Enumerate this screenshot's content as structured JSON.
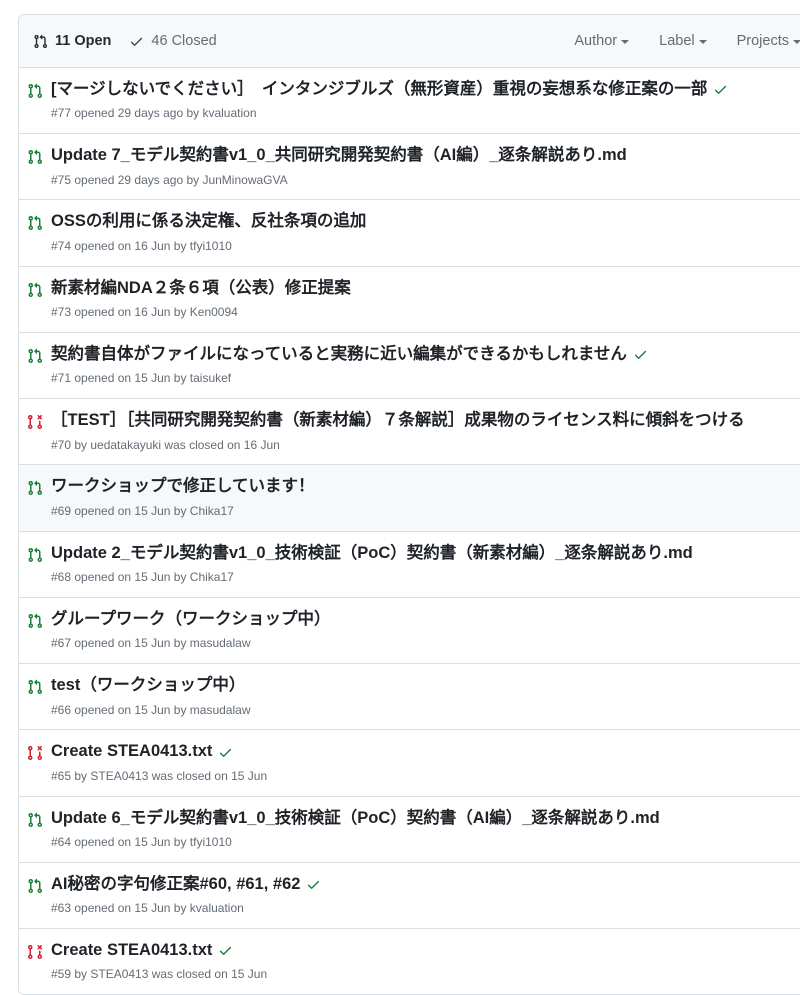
{
  "header": {
    "state_filters": [
      {
        "icon": "pull-request-icon",
        "label": "11 Open",
        "selected": true
      },
      {
        "icon": "check-icon",
        "label": "46 Closed",
        "selected": false
      }
    ],
    "dropdown_filters": [
      {
        "label": "Author"
      },
      {
        "label": "Label"
      },
      {
        "label": "Projects"
      }
    ]
  },
  "colors": {
    "open_green": "#1a7f37",
    "closed_red": "#cf222e",
    "check_green": "#1a7f37",
    "border": "#d8dee4",
    "header_bg": "#f6f8fa",
    "hover_bg": "#f6f8fa",
    "title": "#1f2328",
    "meta": "#636c76"
  },
  "pull_requests": [
    {
      "title": "[マージしないでください］　インタンジブルズ（無形資産）重視の妄想系な修正案の一部",
      "meta": "#77 opened 29 days ago by kvaluation",
      "state": "open",
      "has_check": true,
      "hovered": false
    },
    {
      "title": "Update 7_モデル契約書v1_0_共同研究開発契約書（AI編）_逐条解説あり.md",
      "meta": "#75 opened 29 days ago by JunMinowaGVA",
      "state": "open",
      "has_check": false,
      "hovered": false
    },
    {
      "title": "OSSの利用に係る決定権、反社条項の追加",
      "meta": "#74 opened on 16 Jun by tfyi1010",
      "state": "open",
      "has_check": false,
      "hovered": false
    },
    {
      "title": "新素材編NDA２条６項（公表）修正提案",
      "meta": "#73 opened on 16 Jun by Ken0094",
      "state": "open",
      "has_check": false,
      "hovered": false
    },
    {
      "title": "契約書自体がファイルになっていると実務に近い編集ができるかもしれません",
      "meta": "#71 opened on 15 Jun by taisukef",
      "state": "open",
      "has_check": true,
      "hovered": false
    },
    {
      "title": "［TEST］［共同研究開発契約書（新素材編）７条解説］成果物のライセンス料に傾斜をつける",
      "meta": "#70 by uedatakayuki was closed on 16 Jun",
      "state": "closed",
      "has_check": false,
      "hovered": false
    },
    {
      "title": "ワークショップで修正しています！",
      "meta": "#69 opened on 15 Jun by Chika17",
      "state": "open",
      "has_check": false,
      "hovered": true
    },
    {
      "title": "Update 2_モデル契約書v1_0_技術検証（PoC）契約書（新素材編）_逐条解説あり.md",
      "meta": "#68 opened on 15 Jun by Chika17",
      "state": "open",
      "has_check": false,
      "hovered": false
    },
    {
      "title": "グループワーク（ワークショップ中）",
      "meta": "#67 opened on 15 Jun by masudalaw",
      "state": "open",
      "has_check": false,
      "hovered": false
    },
    {
      "title": "test（ワークショップ中）",
      "meta": "#66 opened on 15 Jun by masudalaw",
      "state": "open",
      "has_check": false,
      "hovered": false
    },
    {
      "title": "Create STEA0413.txt",
      "meta": "#65 by STEA0413 was closed on 15 Jun",
      "state": "closed",
      "has_check": true,
      "hovered": false
    },
    {
      "title": "Update 6_モデル契約書v1_0_技術検証（PoC）契約書（AI編）_逐条解説あり.md",
      "meta": "#64 opened on 15 Jun by tfyi1010",
      "state": "open",
      "has_check": false,
      "hovered": false
    },
    {
      "title": "AI秘密の字句修正案#60, #61, #62",
      "meta": "#63 opened on 15 Jun by kvaluation",
      "state": "open",
      "has_check": true,
      "hovered": false
    },
    {
      "title": "Create STEA0413.txt",
      "meta": "#59 by STEA0413 was closed on 15 Jun",
      "state": "closed",
      "has_check": true,
      "hovered": false
    }
  ]
}
